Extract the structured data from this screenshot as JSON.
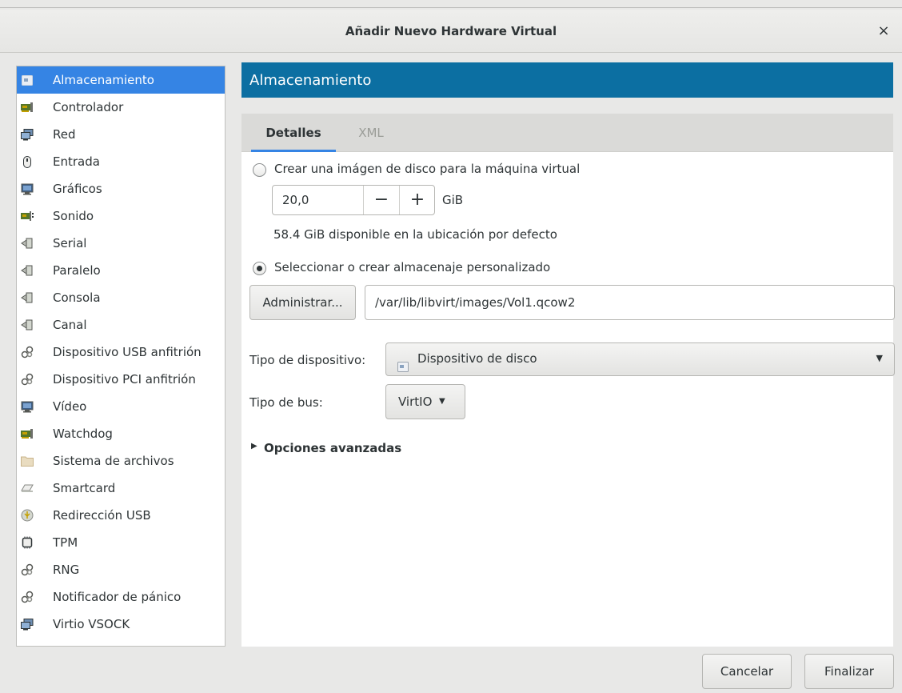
{
  "window": {
    "title": "Añadir Nuevo Hardware Virtual",
    "close_label": "×"
  },
  "sidebar": {
    "items": [
      {
        "label": "Almacenamiento",
        "icon": "storage-icon",
        "selected": true
      },
      {
        "label": "Controlador",
        "icon": "controller-card-icon"
      },
      {
        "label": "Red",
        "icon": "network-icon"
      },
      {
        "label": "Entrada",
        "icon": "mouse-icon"
      },
      {
        "label": "Gráficos",
        "icon": "monitor-icon"
      },
      {
        "label": "Sonido",
        "icon": "sound-card-icon"
      },
      {
        "label": "Serial",
        "icon": "serial-port-icon"
      },
      {
        "label": "Paralelo",
        "icon": "parallel-port-icon"
      },
      {
        "label": "Consola",
        "icon": "console-port-icon"
      },
      {
        "label": "Canal",
        "icon": "channel-port-icon"
      },
      {
        "label": "Dispositivo USB anfitrión",
        "icon": "usb-host-device-icon"
      },
      {
        "label": "Dispositivo PCI anfitrión",
        "icon": "pci-host-device-icon"
      },
      {
        "label": "Vídeo",
        "icon": "video-monitor-icon"
      },
      {
        "label": "Watchdog",
        "icon": "watchdog-card-icon"
      },
      {
        "label": "Sistema de archivos",
        "icon": "folder-icon"
      },
      {
        "label": "Smartcard",
        "icon": "smartcard-icon"
      },
      {
        "label": "Redirección USB",
        "icon": "usb-redirection-icon"
      },
      {
        "label": "TPM",
        "icon": "tpm-chip-icon"
      },
      {
        "label": "RNG",
        "icon": "rng-device-icon"
      },
      {
        "label": "Notificador de pánico",
        "icon": "panic-notifier-icon"
      },
      {
        "label": "Virtio VSOCK",
        "icon": "vsock-icon"
      }
    ]
  },
  "panel": {
    "header": "Almacenamiento",
    "tabs": [
      {
        "label": "Detalles",
        "active": true
      },
      {
        "label": "XML",
        "active": false
      }
    ],
    "create_disk": {
      "label": "Crear una imágen de disco para la máquina virtual",
      "selected": false,
      "size_value": "20,0",
      "minus_label": "−",
      "plus_label": "+",
      "unit": "GiB",
      "available_text": "58.4 GiB disponible en la ubicación por defecto"
    },
    "custom_storage": {
      "label": "Seleccionar o crear almacenaje personalizado",
      "selected": true,
      "manage_button": "Administrar...",
      "path_value": "/var/lib/libvirt/images/Vol1.qcow2"
    },
    "device_type": {
      "label": "Tipo de dispositivo:",
      "value": "Dispositivo de disco",
      "icon": "disk-device-icon"
    },
    "bus_type": {
      "label": "Tipo de bus:",
      "value": "VirtIO"
    },
    "advanced": {
      "label": "Opciones avanzadas"
    }
  },
  "footer": {
    "cancel": "Cancelar",
    "finish": "Finalizar"
  },
  "colors": {
    "selection": "#3584e4",
    "header_bg": "#0c6fa2",
    "window_bg": "#e8e8e7",
    "tab_underline": "#3584e4"
  }
}
